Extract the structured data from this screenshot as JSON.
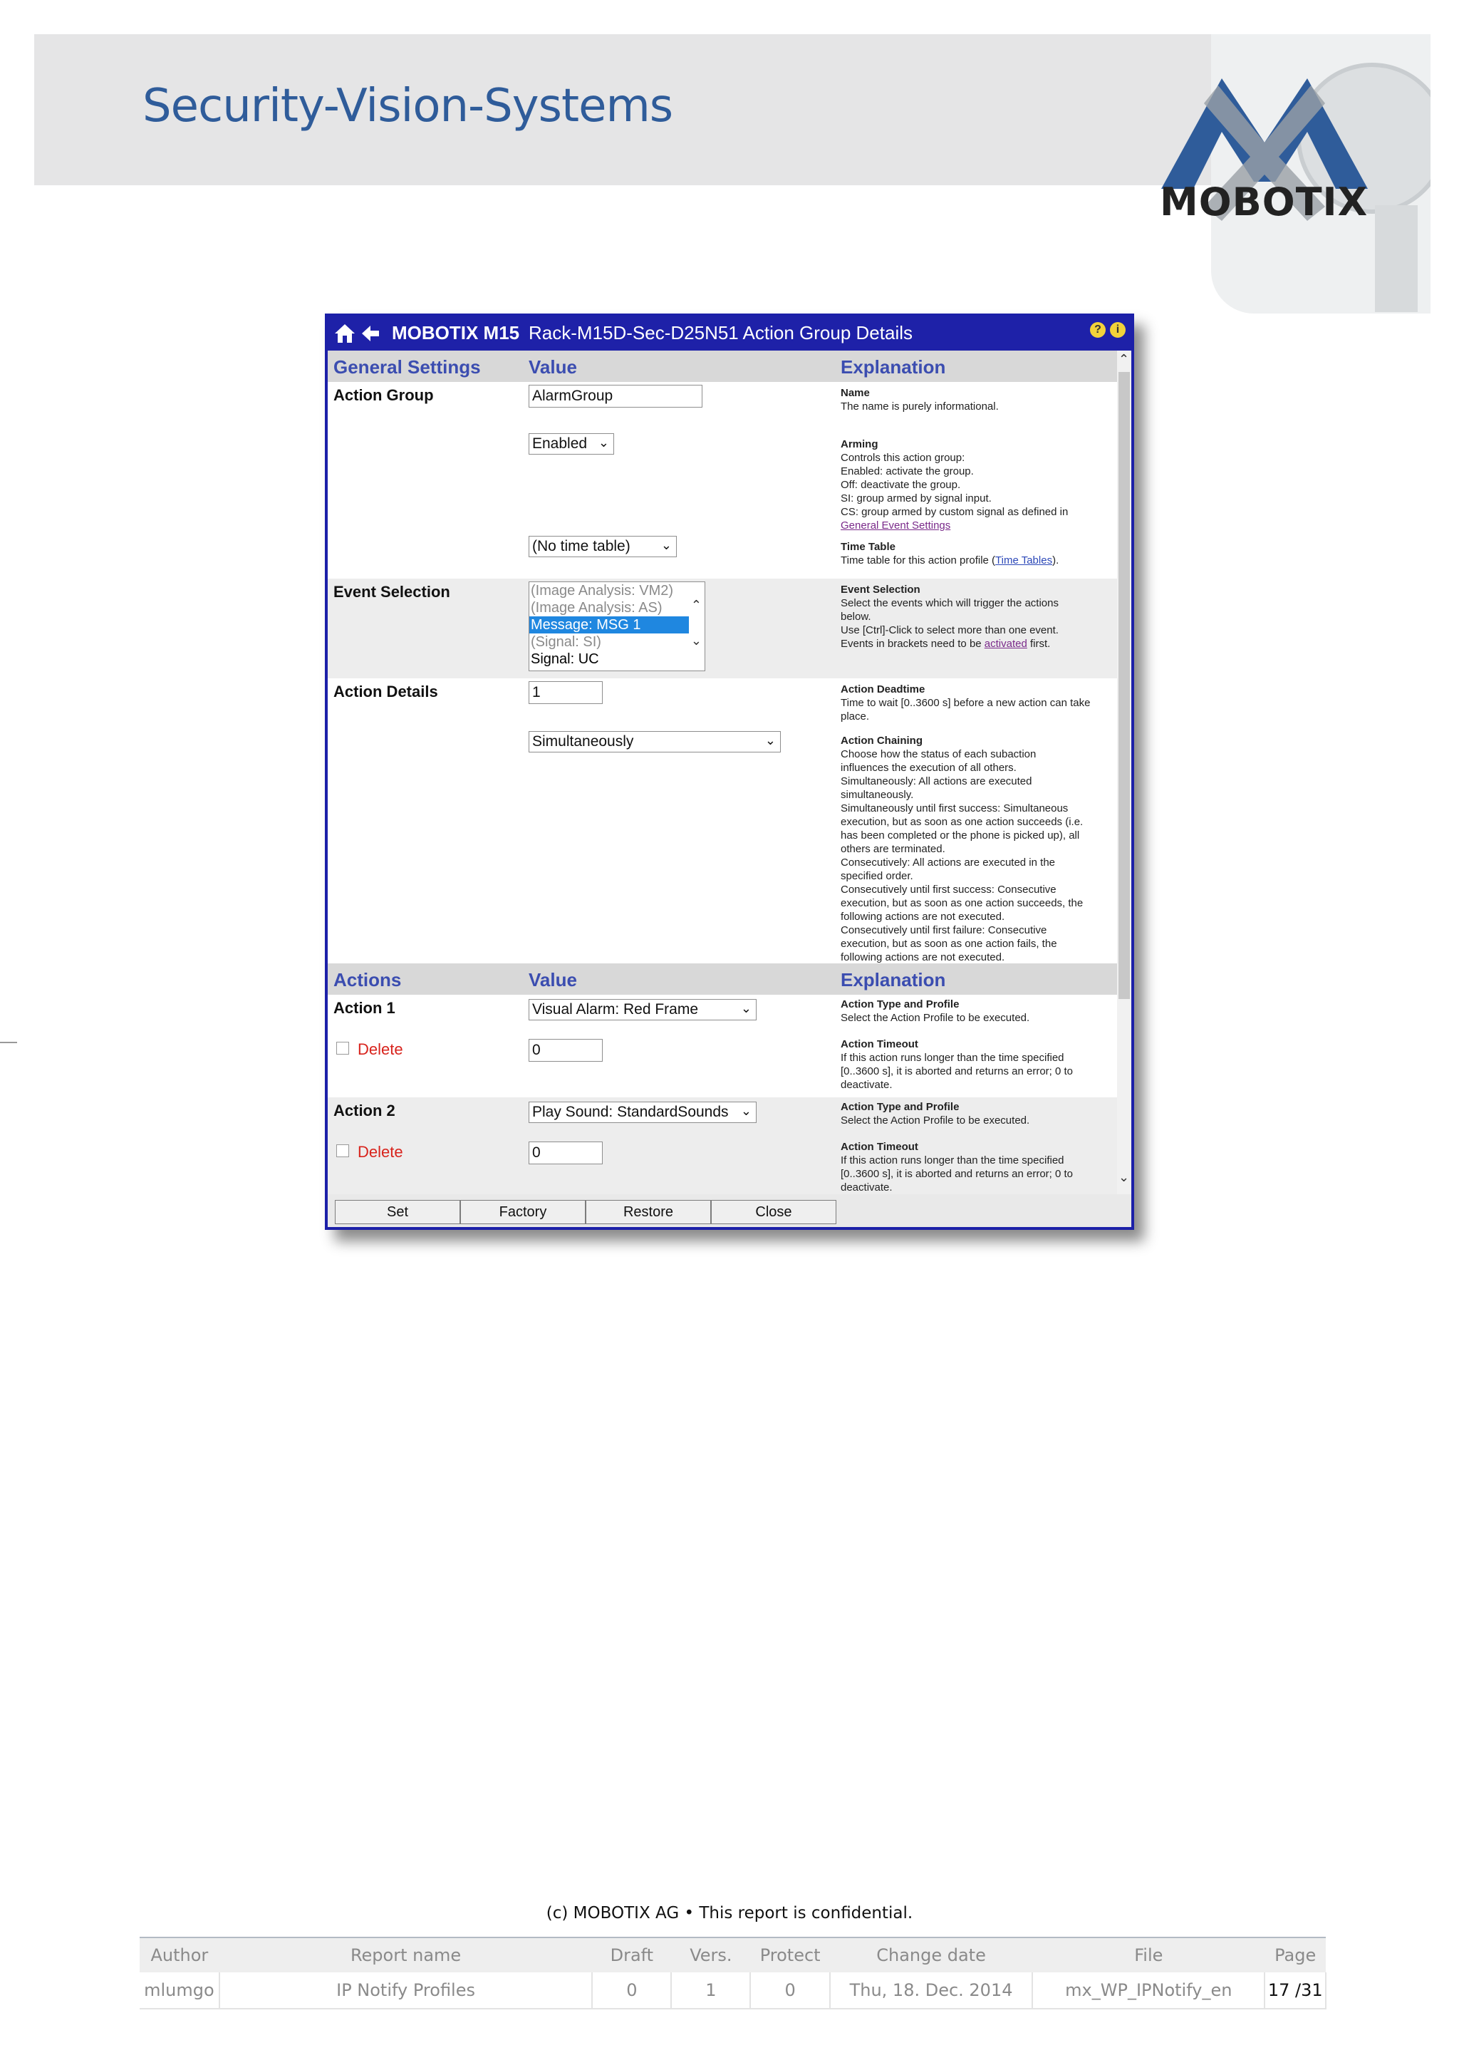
{
  "header": {
    "brand": "Security-Vision-Systems",
    "logo_text": "MOBOTIX",
    "logo_icon": "mobotix-mx-logo"
  },
  "window": {
    "product": "MOBOTIX M15",
    "title": "Rack-M15D-Sec-D25N51 Action Group Details",
    "help_label": "?",
    "info_label": "i",
    "sections": {
      "general": {
        "col1": "General Settings",
        "col2": "Value",
        "col3": "Explanation"
      },
      "actions": {
        "col1": "Actions",
        "col2": "Value",
        "col3": "Explanation"
      }
    },
    "action_group": {
      "label": "Action Group",
      "name_value": "AlarmGroup",
      "arming_value": "Enabled",
      "time_table_value": "(No time table)",
      "exp_name_title": "Name",
      "exp_name_text": "The name is purely informational.",
      "exp_arming_title": "Arming",
      "exp_arming_lines": [
        "Controls this action group:",
        "Enabled: activate the group.",
        "Off: deactivate the group.",
        "SI: group armed by signal input.",
        "CS: group armed by custom signal as defined in"
      ],
      "exp_arming_link": "General Event Settings",
      "exp_tt_title": "Time Table",
      "exp_tt_text": "Time table for this action profile (",
      "exp_tt_link": "Time Tables",
      "exp_tt_end": ")."
    },
    "event_selection": {
      "label": "Event Selection",
      "options": [
        "(Image Analysis: VM2)",
        "(Image Analysis: AS)",
        "Message: MSG 1",
        "(Signal: SI)",
        "Signal: UC"
      ],
      "selected": "Message: MSG 1",
      "exp_title": "Event Selection",
      "exp_lines": [
        "Select the events which will trigger the actions",
        "below.",
        "Use [Ctrl]-Click to select more than one event."
      ],
      "exp_last_pre": "Events in brackets need to be ",
      "exp_last_link": "activated",
      "exp_last_post": " first."
    },
    "action_details": {
      "label": "Action Details",
      "deadtime_value": "1",
      "chaining_value": "Simultaneously",
      "exp_deadtime_title": "Action Deadtime",
      "exp_deadtime_text": "Time to wait [0..3600 s] before a new action can take place.",
      "exp_chaining_title": "Action Chaining",
      "exp_chaining_lines": [
        "Choose how the status of each subaction",
        "influences the execution of all others.",
        "Simultaneously: All actions are executed",
        "simultaneously.",
        "Simultaneously until first success: Simultaneous",
        "execution, but as soon as one action succeeds (i.e.",
        "has been completed or the phone is picked up), all",
        "others are terminated.",
        "Consecutively: All actions are executed in the",
        "specified order.",
        "Consecutively until first success: Consecutive",
        "execution, but as soon as one action succeeds, the",
        "following actions are not executed.",
        "Consecutively until first failure: Consecutive",
        "execution, but as soon as one action fails, the",
        "following actions are not executed."
      ]
    },
    "action1": {
      "label": "Action 1",
      "delete_label": "Delete",
      "profile_value": "Visual Alarm: Red Frame",
      "timeout_value": "0",
      "exp_type_title": "Action Type and Profile",
      "exp_type_text": "Select the Action Profile to be executed.",
      "exp_timeout_title": "Action Timeout",
      "exp_timeout_lines": [
        "If this action runs longer than the time specified",
        "[0..3600 s], it is aborted and returns an error; 0 to",
        "deactivate."
      ]
    },
    "action2": {
      "label": "Action 2",
      "delete_label": "Delete",
      "profile_value": "Play Sound: StandardSounds",
      "timeout_value": "0",
      "exp_type_title": "Action Type and Profile",
      "exp_type_text": "Select the Action Profile to be executed.",
      "exp_timeout_title": "Action Timeout",
      "exp_timeout_lines": [
        "If this action runs longer than the time specified",
        "[0..3600 s], it is aborted and returns an error; 0 to",
        "deactivate."
      ]
    },
    "buttons": {
      "set": "Set",
      "factory": "Factory",
      "restore": "Restore",
      "close": "Close"
    }
  },
  "footer": {
    "confidential": "(c) MOBOTIX AG  •  This report is confidential.",
    "headers": [
      "Author",
      "Report name",
      "Draft",
      "Vers.",
      "Protect",
      "Change date",
      "File",
      "Page"
    ],
    "values": [
      "mlumgo",
      "IP Notify Profiles",
      "0",
      "1",
      "0",
      "Thu, 18. Dec. 2014",
      "mx_WP_IPNotify_en",
      "17 /31"
    ]
  }
}
